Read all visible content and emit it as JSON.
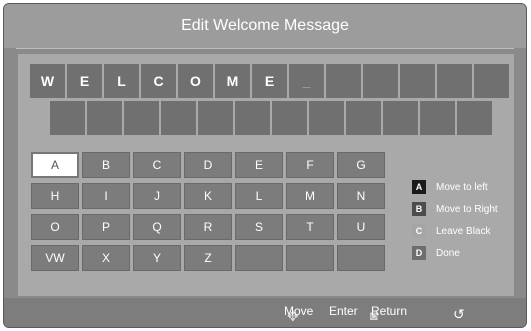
{
  "title": "Edit Welcome Message",
  "message_row1": [
    "W",
    "E",
    "L",
    "C",
    "O",
    "M",
    "E",
    "_",
    "",
    "",
    "",
    "",
    ""
  ],
  "message_row2": [
    "",
    "",
    "",
    "",
    "",
    "",
    "",
    "",
    "",
    "",
    "",
    ""
  ],
  "keypad": [
    [
      "A",
      "B",
      "C",
      "D",
      "E",
      "F",
      "G"
    ],
    [
      "H",
      "I",
      "J",
      "K",
      "L",
      "M",
      "N"
    ],
    [
      "O",
      "P",
      "Q",
      "R",
      "S",
      "T",
      "U"
    ],
    [
      "VW",
      "X",
      "Y",
      "Z",
      "",
      "",
      ""
    ]
  ],
  "selected_key": "A",
  "legend": [
    {
      "badge": "A",
      "label": "Move to left"
    },
    {
      "badge": "B",
      "label": "Move to Right"
    },
    {
      "badge": "C",
      "label": "Leave Black"
    },
    {
      "badge": "D",
      "label": "Done"
    }
  ],
  "bottom_bar": {
    "move": "Move",
    "enter": "Enter",
    "return": "Return"
  },
  "icons": {
    "nav": "navigate-icon",
    "enter": "enter-icon",
    "return": "return-arrow-icon"
  },
  "colors": {
    "background": "#8a8a8a",
    "panel": "#a9a9a9",
    "cell": "#707070",
    "key": "#7c7c7c",
    "selected_key": "#ffffff"
  }
}
